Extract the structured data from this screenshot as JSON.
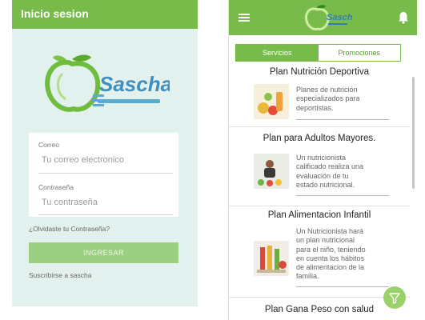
{
  "login": {
    "title": "Inicio sesion",
    "brand": "Sascha",
    "email_label": "Correo",
    "email_placeholder": "Tu correo electronico",
    "password_label": "Contraseña",
    "password_placeholder": "Tu contraseña",
    "forgot_link": "¿Olvidaste tu Contraseña?",
    "submit_label": "INGRESAR",
    "subscribe_link": "Suscribirse a sascha"
  },
  "services": {
    "brand": "Sascha",
    "tabs": [
      {
        "label": "Servicios",
        "active": true
      },
      {
        "label": "Promociones",
        "active": false
      }
    ],
    "plans": [
      {
        "title": "Plan Nutrición Deportiva",
        "description": [
          "Planes de nutrición",
          "especializados para",
          "deportistas."
        ]
      },
      {
        "title": "Plan para Adultos Mayores.",
        "description": [
          "Un nutricionista",
          "calificado realiza una",
          "evaluación de tu",
          "estado nutricional."
        ]
      },
      {
        "title": "Plan Alimentacion Infantil",
        "description": [
          "Un Nutricionista hará",
          "un plan nutricional",
          "para el niño, teniendo",
          "en cuenta los hábitos",
          "de alimentacion de la",
          "familia."
        ]
      },
      {
        "title": "Plan Gana Peso con salud",
        "description": []
      }
    ]
  },
  "colors": {
    "primary_green": "#79bb4a",
    "login_background": "#e3f1ee",
    "button_green": "#9dcf82",
    "fab_green": "#9bd16a"
  },
  "icons": [
    "hamburger-menu-icon",
    "bell-icon",
    "filter-icon",
    "apple-logo-icon"
  ]
}
